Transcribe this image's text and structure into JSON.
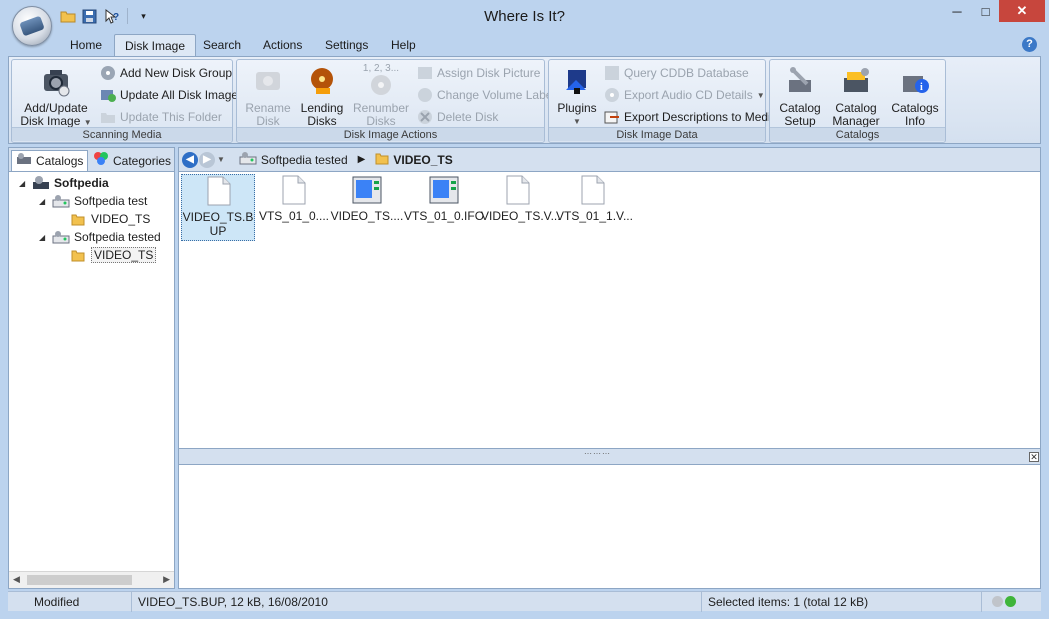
{
  "window": {
    "title": "Where Is It?",
    "minimize": "─",
    "maximize": "□",
    "close": "✕"
  },
  "tabs": [
    "Home",
    "Disk Image",
    "Search",
    "Actions",
    "Settings",
    "Help"
  ],
  "active_tab": "Disk Image",
  "ribbon": {
    "scanning_media": {
      "label": "Scanning Media",
      "add_update_line1": "Add/Update",
      "add_update_line2": "Disk Image",
      "add_new_disk_group": "Add New Disk Group",
      "update_all_disk_images": "Update All Disk Images",
      "update_this_folder": "Update This Folder"
    },
    "disk_image_actions": {
      "label": "Disk Image Actions",
      "rename_line1": "Rename",
      "rename_line2": "Disk",
      "lending_line1": "Lending",
      "lending_line2": "Disks",
      "renumber_top": "1, 2, 3...",
      "renumber_line1": "Renumber",
      "renumber_line2": "Disks",
      "assign_disk_picture": "Assign Disk Picture",
      "change_volume_label": "Change Volume Label",
      "delete_disk": "Delete Disk"
    },
    "disk_image_data": {
      "label": "Disk Image Data",
      "plugins": "Plugins",
      "query_cddb": "Query CDDB Database",
      "export_audio_cd": "Export Audio CD Details",
      "export_descriptions": "Export Descriptions to Media"
    },
    "catalogs": {
      "label": "Catalogs",
      "setup_line1": "Catalog",
      "setup_line2": "Setup",
      "manager_line1": "Catalog",
      "manager_line2": "Manager",
      "info_line1": "Catalogs",
      "info_line2": "Info"
    }
  },
  "left_pane": {
    "tab_catalogs": "Catalogs",
    "tab_categories": "Categories",
    "tree": [
      {
        "label": "Softpedia",
        "level": 0,
        "bold": true
      },
      {
        "label": "Softpedia test",
        "level": 1
      },
      {
        "label": "VIDEO_TS",
        "level": 2
      },
      {
        "label": "Softpedia tested",
        "level": 1
      },
      {
        "label": "VIDEO_TS",
        "level": 2,
        "selected": true
      }
    ]
  },
  "breadcrumb": {
    "disk": "Softpedia tested",
    "folder": "VIDEO_TS"
  },
  "files": [
    {
      "name": "VIDEO_TS.BUP",
      "icon": "blank-file-icon",
      "selected": true
    },
    {
      "name": "VTS_01_0....",
      "icon": "blank-file-icon"
    },
    {
      "name": "VIDEO_TS....",
      "icon": "ifo-file-icon"
    },
    {
      "name": "VTS_01_0.IFO",
      "icon": "ifo-file-icon"
    },
    {
      "name": "VIDEO_TS.V...",
      "icon": "blank-file-icon"
    },
    {
      "name": "VTS_01_1.V...",
      "icon": "blank-file-icon"
    }
  ],
  "status": {
    "state": "Modified",
    "file_info": "VIDEO_TS.BUP, 12 kB, 16/08/2010",
    "selection": "Selected items: 1 (total 12 kB)"
  },
  "colors": {
    "frame": "#bcd3ee",
    "ribbon": "#d4e0ef",
    "selection": "#cde6f7",
    "close": "#c7463d"
  }
}
